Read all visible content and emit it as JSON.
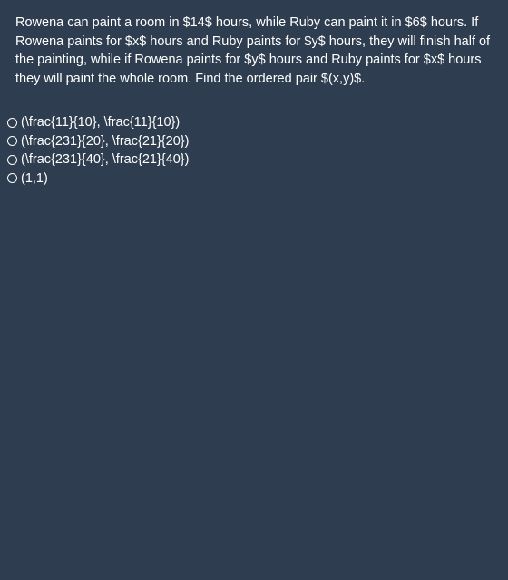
{
  "question": {
    "text": "Rowena can paint a room in $14$ hours, while Ruby can paint it in $6$ hours. If Rowena paints for $x$ hours and Ruby paints for $y$ hours, they will finish half of the painting, while if Rowena paints for $y$ hours and Ruby paints for $x$ hours they will paint the whole room. Find the ordered pair $(x,y)$."
  },
  "options": [
    {
      "label": "(\\frac{11}{10}, \\frac{11}{10})"
    },
    {
      "label": "(\\frac{231}{20}, \\frac{21}{20})"
    },
    {
      "label": "(\\frac{231}{40}, \\frac{21}{40})"
    },
    {
      "label": "(1,1)"
    }
  ]
}
